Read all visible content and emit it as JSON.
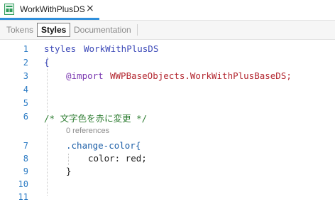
{
  "tab": {
    "title": "WorkWithPlusDS",
    "close_symbol": "×"
  },
  "subtabs": [
    {
      "label": "Tokens",
      "active": false
    },
    {
      "label": "Styles",
      "active": true
    },
    {
      "label": "Documentation",
      "active": false
    }
  ],
  "editor": {
    "line_numbers": [
      "1",
      "2",
      "3",
      "4",
      "5",
      "6",
      "7",
      "8",
      "9",
      "10",
      "11"
    ],
    "lines": {
      "l1_kw": "styles",
      "l1_name": "WorkWithPlusDS",
      "l2": "{",
      "l3_at": "@import",
      "l3_arg": "WWPBaseObjects.WorkWithPlusBaseDS;",
      "l6_comment": "/* 文字色を赤に変更 */",
      "codelens": "0 references",
      "l7_selector": ".change-color{",
      "l8_prop": "color: red;",
      "l9": "}"
    }
  }
}
